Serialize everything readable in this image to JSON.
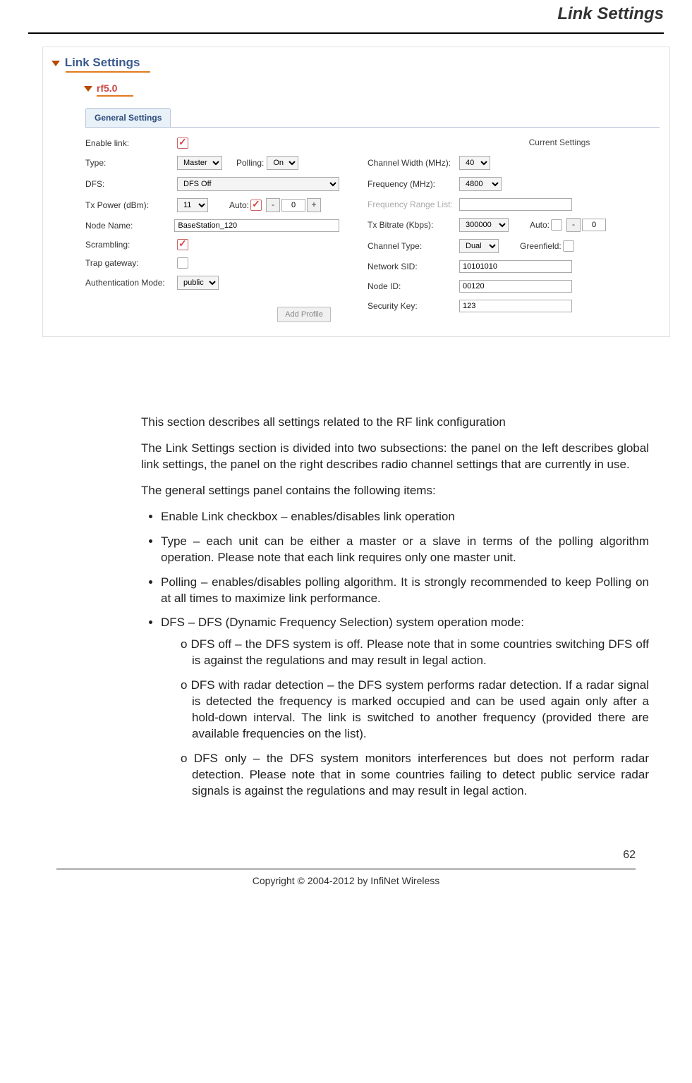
{
  "header": {
    "title": "Link Settings"
  },
  "screenshot": {
    "link_settings_label": "Link Settings",
    "rf_label": "rf5.0",
    "general_settings_tab": "General Settings",
    "left": {
      "enable_link_label": "Enable link:",
      "type_label": "Type:",
      "type_value": "Master",
      "polling_label": "Polling:",
      "polling_value": "On",
      "dfs_label": "DFS:",
      "dfs_value": "DFS Off",
      "txpower_label": "Tx Power (dBm):",
      "txpower_value": "11",
      "auto_label": "Auto:",
      "auto_value": "0",
      "nodename_label": "Node Name:",
      "nodename_value": "BaseStation_120",
      "scrambling_label": "Scrambling:",
      "trap_label": "Trap gateway:",
      "auth_label": "Authentication Mode:",
      "auth_value": "public"
    },
    "right": {
      "current_label": "Current Settings",
      "chwidth_label": "Channel Width (MHz):",
      "chwidth_value": "40",
      "freq_label": "Frequency (MHz):",
      "freq_value": "4800",
      "frl_label": "Frequency Range List:",
      "txbitrate_label": "Tx Bitrate (Kbps):",
      "txbitrate_value": "300000",
      "auto_label": "Auto:",
      "auto_value": "0",
      "chtype_label": "Channel Type:",
      "chtype_value": "Dual",
      "greenfield_label": "Greenfield:",
      "sid_label": "Network SID:",
      "sid_value": "10101010",
      "nodeid_label": "Node ID:",
      "nodeid_value": "00120",
      "seckey_label": "Security Key:",
      "seckey_value": "123"
    },
    "add_profile_label": "Add Profile"
  },
  "body": {
    "p1": "This section describes all settings related to the RF link configuration",
    "p2": "The Link Settings section is divided into two subsections: the panel on the left describes global link settings, the panel on the right describes radio channel settings that are currently in use.",
    "p3": "The general settings panel contains the following items:",
    "b1": "Enable Link checkbox – enables/disables link operation",
    "b2": "Type – each unit can be either a master or a slave in terms of the polling algorithm operation. Please note that each link requires only one master unit.",
    "b3": "Polling – enables/disables polling algorithm. It is strongly recommended to keep Polling on at all times to maximize link performance.",
    "b4": "DFS – DFS (Dynamic Frequency Selection) system operation mode:",
    "s1": "DFS off – the DFS system is off. Please note that in some countries switching DFS off is against the regulations and may result in legal action.",
    "s2": "DFS with radar detection – the DFS system performs radar detection. If a radar signal is detected the frequency is marked occupied and can be used again only after a hold-down interval. The link is switched to another frequency (provided there are available frequencies on the list).",
    "s3": "DFS only – the DFS system monitors interferences but does not perform radar detection. Please note that in some countries failing to detect public service radar signals is against the regulations and may result in legal action."
  },
  "footer": {
    "page_number": "62",
    "copyright": "Copyright © 2004-2012 by InfiNet Wireless"
  }
}
